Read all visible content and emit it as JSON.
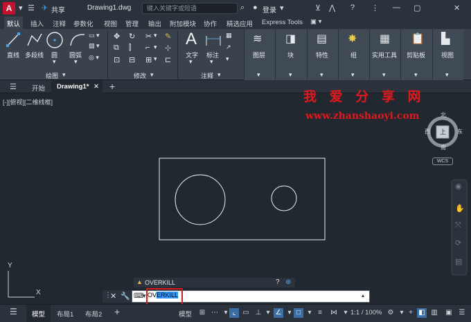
{
  "titlebar": {
    "app_letter": "A",
    "share": "共享",
    "doc_title": "Drawing1.dwg",
    "search_placeholder": "键入关键字或短语",
    "login": "登录"
  },
  "ribbon_tabs": [
    "默认",
    "插入",
    "注释",
    "参数化",
    "视图",
    "管理",
    "输出",
    "附加模块",
    "协作",
    "精选应用",
    "Express Tools"
  ],
  "ribbon": {
    "draw": {
      "line": "直线",
      "polyline": "多段线",
      "circle": "圆",
      "arc": "圆弧",
      "group_label": "绘图"
    },
    "modify": {
      "group_label": "修改"
    },
    "annotation": {
      "text": "文字",
      "dimension": "标注",
      "group_label": "注释"
    },
    "panels": [
      "图层",
      "块",
      "特性",
      "组",
      "实用工具",
      "剪贴板",
      "视图"
    ]
  },
  "file_tabs": {
    "start": "开始",
    "drawing": "Drawing1*"
  },
  "canvas": {
    "view_label": "[-][俯视][二维线框]",
    "watermark_title": "我 爱 分 享 网",
    "watermark_url": "www.zhanshaoyi.com",
    "viewcube": {
      "north": "北",
      "south": "南",
      "west": "西",
      "east": "东",
      "top": "上",
      "wcs": "WCS"
    },
    "ucs_x": "X",
    "ucs_y": "Y"
  },
  "command": {
    "history": "OVERKILL",
    "input_prefix": "OV",
    "input_selected": "ERKILL"
  },
  "statusbar": {
    "model_tab": "模型",
    "layout1": "布局1",
    "layout2": "布局2",
    "model_label": "模型",
    "scale": "1:1 / 100%"
  },
  "colors": {
    "accent": "#3a6ea5",
    "watermark": "#e0191e",
    "canvas": "#212830"
  }
}
